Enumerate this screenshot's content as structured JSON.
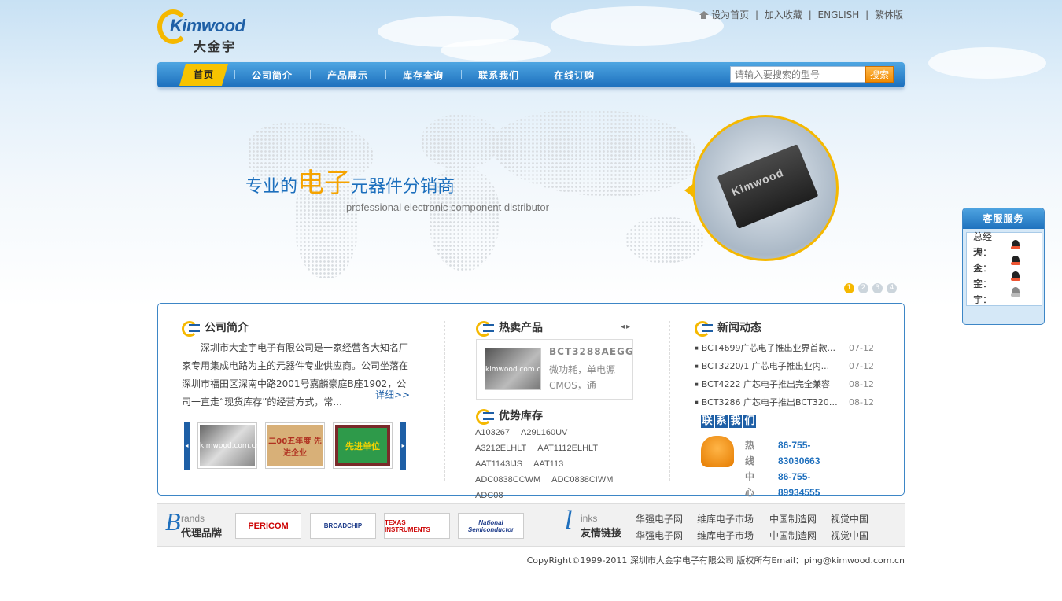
{
  "header": {
    "logo_en": "Kimwood",
    "logo_cn": "大金宇",
    "top_links": [
      "设为首页",
      "加入收藏",
      "ENGLISH",
      "繁体版"
    ]
  },
  "nav": {
    "items": [
      "首页",
      "公司简介",
      "产品展示",
      "库存查询",
      "联系我们",
      "在线订购"
    ],
    "active_index": 0,
    "search_placeholder": "请输入要搜索的型号",
    "search_button": "搜索"
  },
  "banner": {
    "tagline_pre": "专业的",
    "tagline_big": "电子",
    "tagline_post": "元器件分销商",
    "subtitle": "professional electronic component distributor",
    "chip_text": "Kimwood",
    "slides": [
      "1",
      "2",
      "3",
      "4"
    ],
    "active_slide": 0
  },
  "service": {
    "title": "客服服务",
    "contacts": [
      {
        "label": "总经理：",
        "online": true
      },
      {
        "label": "大　大：",
        "online": true
      },
      {
        "label": "金　金：",
        "online": true
      },
      {
        "label": "宇　宇：",
        "online": false
      }
    ]
  },
  "about": {
    "title": "公司简介",
    "text": "深圳市大金宇电子有限公司是一家经营各大知名厂家专用集成电路为主的元器件专业供应商。公司坐落在深圳市福田区深南中路2001号嘉麟豪庭B座1902，公司一直走“现货库存”的经营方式，常...",
    "more": "详细>>",
    "certs": [
      "kimwood.com.cn",
      "二00五年度 先进企业",
      "先进单位"
    ]
  },
  "hot": {
    "title": "热卖产品",
    "arrows": "◂▸",
    "product_name": "BCT3288AEGG",
    "product_desc": "微功耗，单电源CMOS，通",
    "product_img_text": "kimwood.com.cn"
  },
  "stock": {
    "title": "优势库存",
    "items": [
      "A103267",
      "A29L160UV",
      "A3212ELHLT",
      "AAT1112ELHLT",
      "AAT1143IJS",
      "AAT113",
      "ADC0838CCWM",
      "ADC0838CIWM",
      "ADC08"
    ]
  },
  "news": {
    "title": "新闻动态",
    "items": [
      {
        "title": "BCT4699广芯电子推出业界首款...",
        "date": "07-12"
      },
      {
        "title": "BCT3220/1 广芯电子推出业内...",
        "date": "07-12"
      },
      {
        "title": "BCT4222 广芯电子推出完全兼容",
        "date": "08-12"
      },
      {
        "title": "BCT3286 广芯电子推出BCT320炫...",
        "date": "08-12"
      }
    ]
  },
  "contact": {
    "title_chars": [
      "联",
      "系",
      "我",
      "们"
    ],
    "hotline_label": "热 线",
    "center_label": "中 心",
    "phone1": "86-755-83030663",
    "phone2": "86-755-89934555"
  },
  "footer": {
    "brands_en": "rands",
    "brands_cn": "代理品牌",
    "brands_letter": "B",
    "brands": [
      "PERICOM",
      "BROADCHIP",
      "TEXAS INSTRUMENTS",
      "National Semiconductor"
    ],
    "links_letter": "l",
    "links_en": "inks",
    "links_cn": "友情链接",
    "links": [
      "华强电子网",
      "维库电子市场",
      "中国制造网",
      "视觉中国",
      "华强电子网",
      "维库电子市场",
      "中国制造网",
      "视觉中国"
    ],
    "copyright": "CopyRight©1999-2011  深圳市大金宇电子有限公司  版权所有Email：ping@kimwood.com.cn"
  },
  "colors": {
    "accent_blue": "#1e6fbd",
    "accent_yellow": "#f5b800"
  }
}
